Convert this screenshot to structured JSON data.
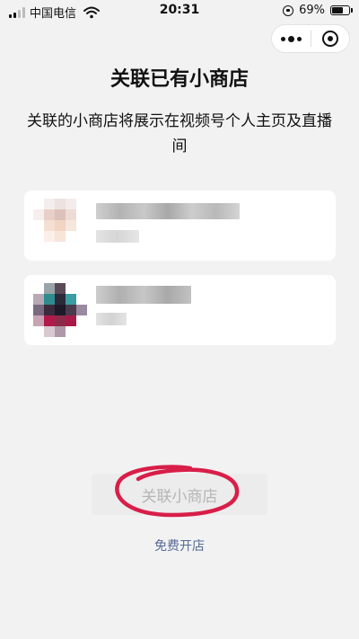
{
  "status_bar": {
    "carrier": "中国电信",
    "time": "20:31",
    "battery": "69%",
    "battery_level": 0.69
  },
  "capsule": {
    "more_icon": "more-dots-icon",
    "close_icon": "target-circle-icon"
  },
  "page": {
    "title": "关联已有小商店",
    "subtitle": "关联的小商店将展示在视频号个人主页及直播间"
  },
  "primary_button": {
    "label": "关联小商店",
    "state": "disabled"
  },
  "secondary_link": {
    "label": "免费开店",
    "color": "#576b95"
  },
  "annotation": {
    "color": "#d81e49"
  },
  "colors": {
    "background": "#f2f2f2",
    "card": "#ffffff",
    "button_disabled_bg": "#ececec",
    "button_disabled_text": "#b5b5b5"
  }
}
